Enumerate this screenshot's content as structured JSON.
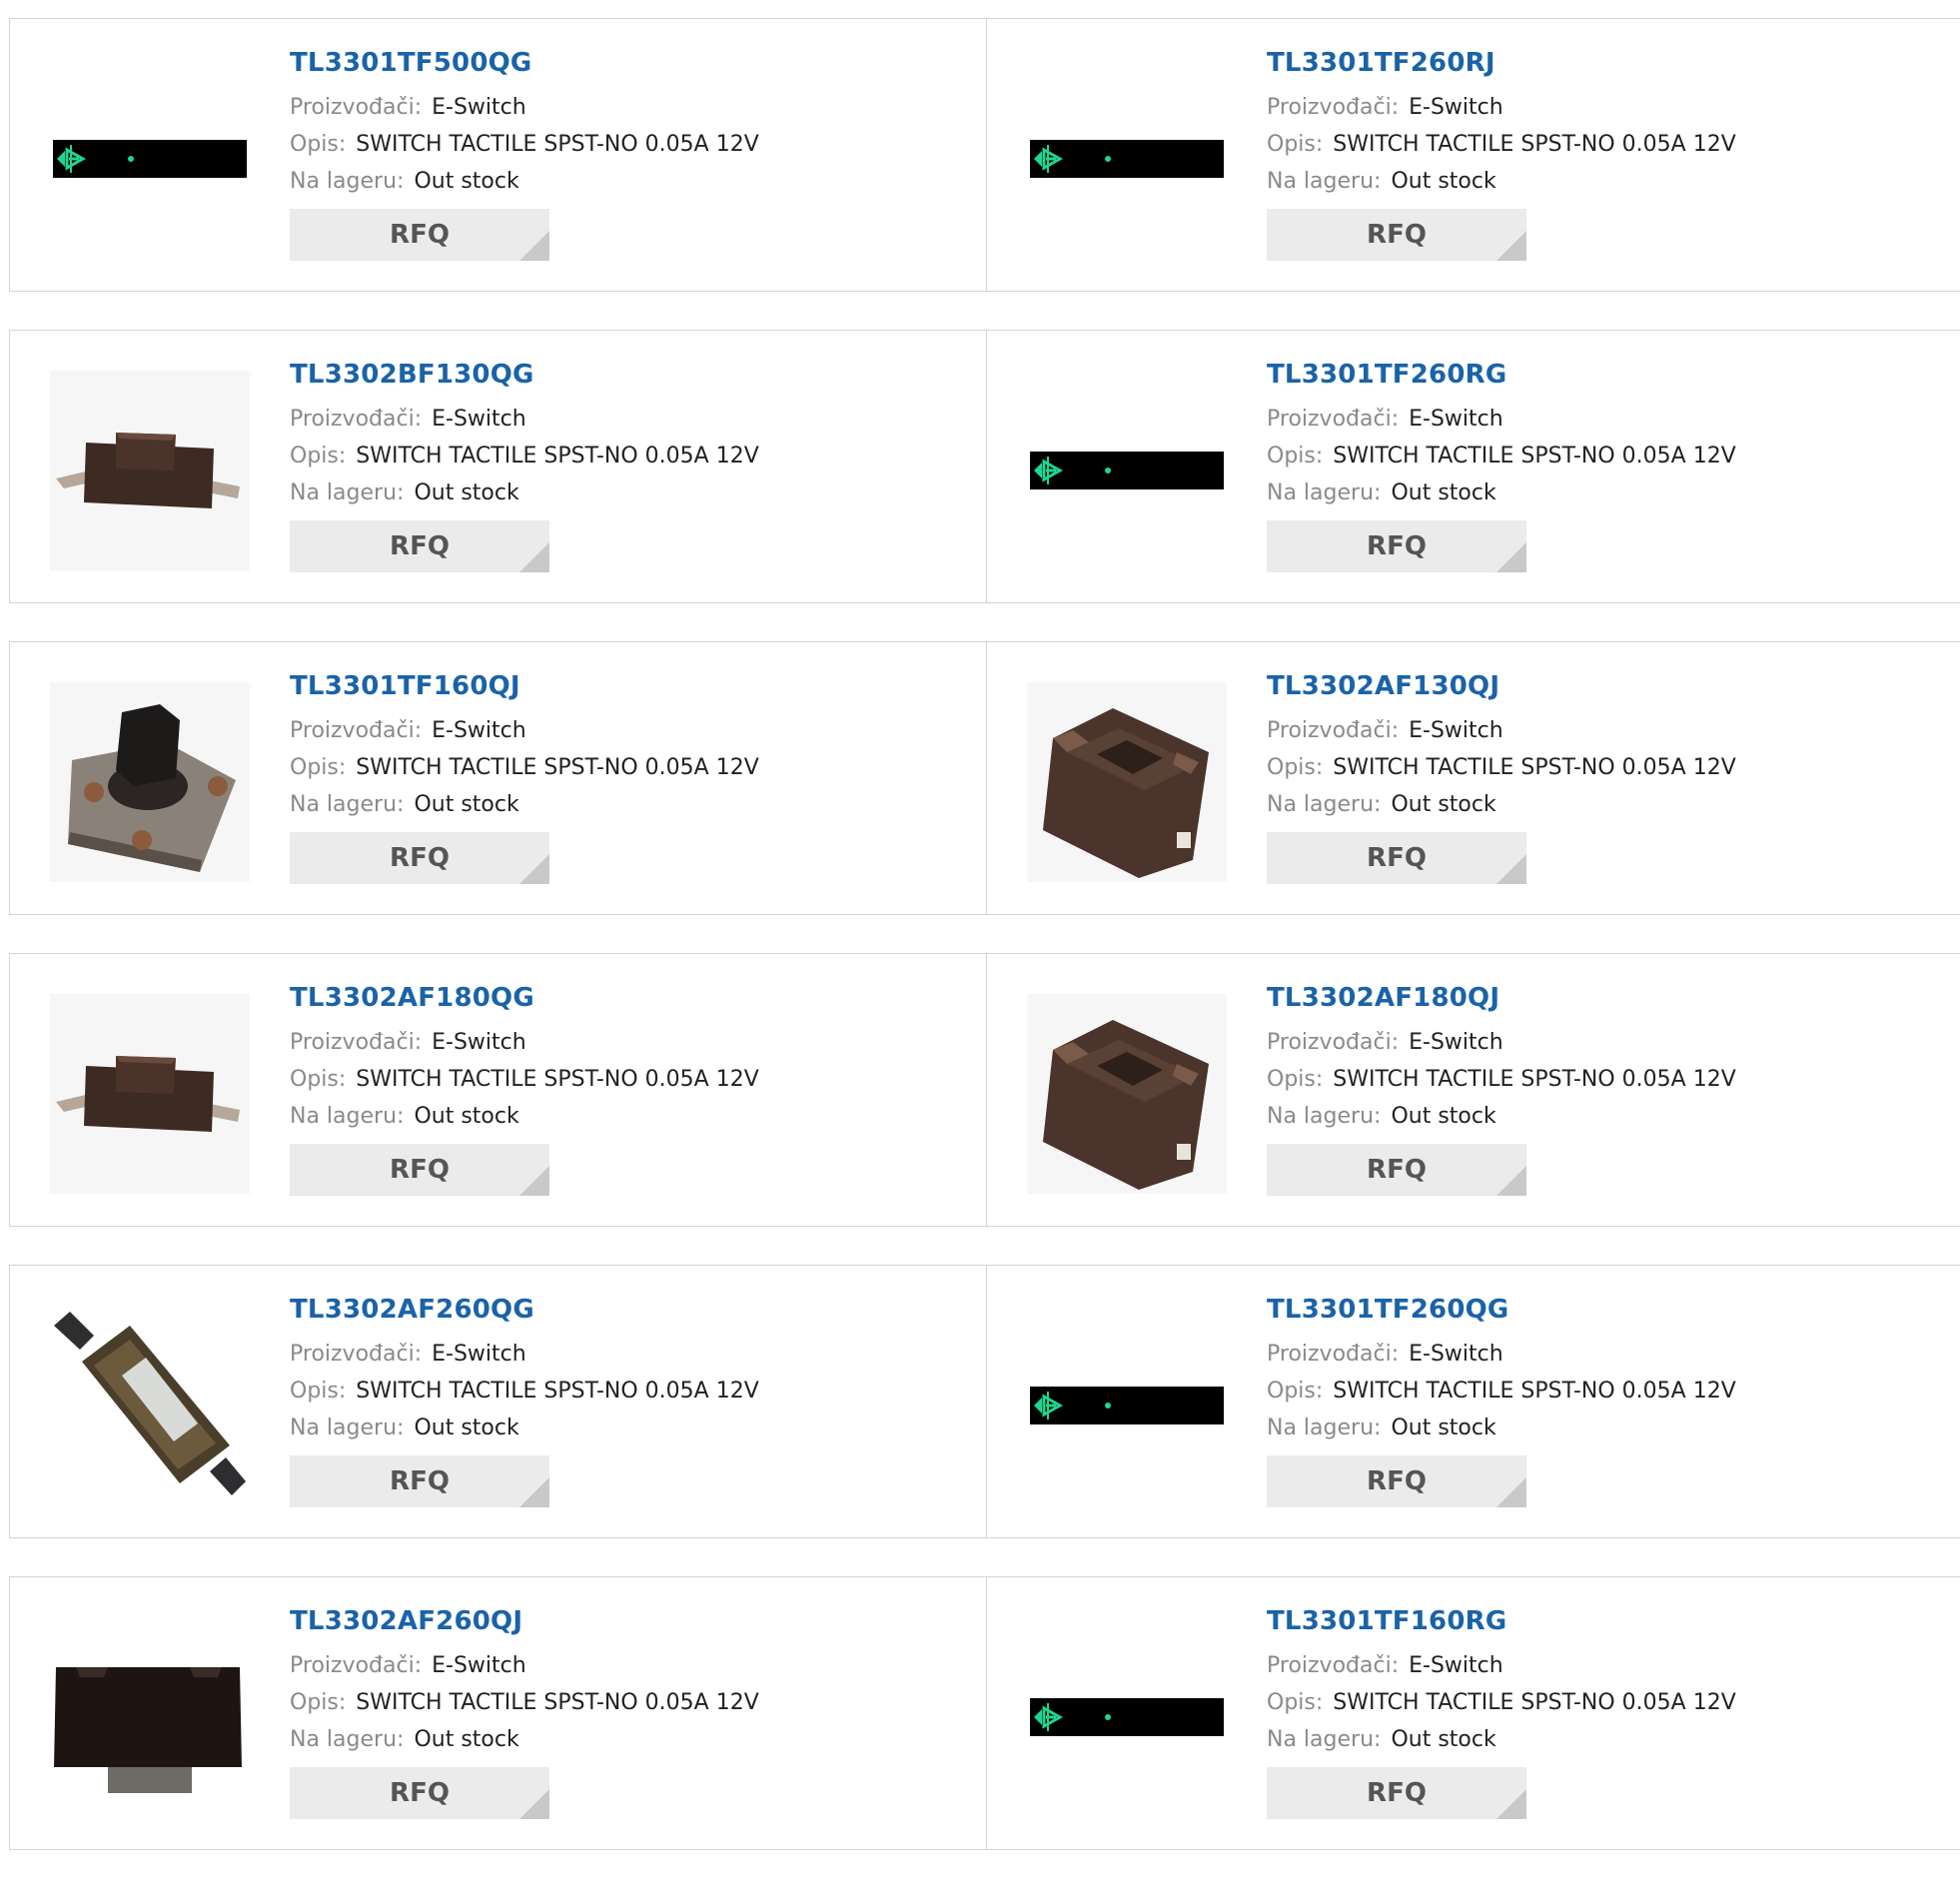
{
  "labels": {
    "manufacturer": "Proizvođači:",
    "description": "Opis:",
    "stock": "Na lageru:",
    "rfq": "RFQ"
  },
  "colors": {
    "part_link": "#1a63a8",
    "label_gray": "#8a8a8a",
    "value_text": "#222222",
    "rfq_bg": "#ebebeb",
    "border": "#d3d3d3"
  },
  "products": [
    {
      "part": "TL3301TF500QG",
      "manufacturer": "E-Switch",
      "description": "SWITCH TACTILE SPST-NO 0.05A 12V",
      "stock": "Out stock",
      "image": "placeholder-icon"
    },
    {
      "part": "TL3301TF260RJ",
      "manufacturer": "E-Switch",
      "description": "SWITCH TACTILE SPST-NO 0.05A 12V",
      "stock": "Out stock",
      "image": "placeholder-icon"
    },
    {
      "part": "TL3302BF130QG",
      "manufacturer": "E-Switch",
      "description": "SWITCH TACTILE SPST-NO 0.05A 12V",
      "stock": "Out stock",
      "image": "smd-switch-photo"
    },
    {
      "part": "TL3301TF260RG",
      "manufacturer": "E-Switch",
      "description": "SWITCH TACTILE SPST-NO 0.05A 12V",
      "stock": "Out stock",
      "image": "placeholder-icon"
    },
    {
      "part": "TL3301TF160QJ",
      "manufacturer": "E-Switch",
      "description": "SWITCH TACTILE SPST-NO 0.05A 12V",
      "stock": "Out stock",
      "image": "square-switch-photo"
    },
    {
      "part": "TL3302AF130QJ",
      "manufacturer": "E-Switch",
      "description": "SWITCH TACTILE SPST-NO 0.05A 12V",
      "stock": "Out stock",
      "image": "block-switch-photo"
    },
    {
      "part": "TL3302AF180QG",
      "manufacturer": "E-Switch",
      "description": "SWITCH TACTILE SPST-NO 0.05A 12V",
      "stock": "Out stock",
      "image": "smd-switch-photo"
    },
    {
      "part": "TL3302AF180QJ",
      "manufacturer": "E-Switch",
      "description": "SWITCH TACTILE SPST-NO 0.05A 12V",
      "stock": "Out stock",
      "image": "block-switch-photo"
    },
    {
      "part": "TL3302AF260QG",
      "manufacturer": "E-Switch",
      "description": "SWITCH TACTILE SPST-NO 0.05A 12V",
      "stock": "Out stock",
      "image": "diagonal-switch-photo"
    },
    {
      "part": "TL3301TF260QG",
      "manufacturer": "E-Switch",
      "description": "SWITCH TACTILE SPST-NO 0.05A 12V",
      "stock": "Out stock",
      "image": "placeholder-icon"
    },
    {
      "part": "TL3302AF260QJ",
      "manufacturer": "E-Switch",
      "description": "SWITCH TACTILE SPST-NO 0.05A 12V",
      "stock": "Out stock",
      "image": "black-block-switch-photo"
    },
    {
      "part": "TL3301TF160RG",
      "manufacturer": "E-Switch",
      "description": "SWITCH TACTILE SPST-NO 0.05A 12V",
      "stock": "Out stock",
      "image": "placeholder-icon"
    }
  ]
}
